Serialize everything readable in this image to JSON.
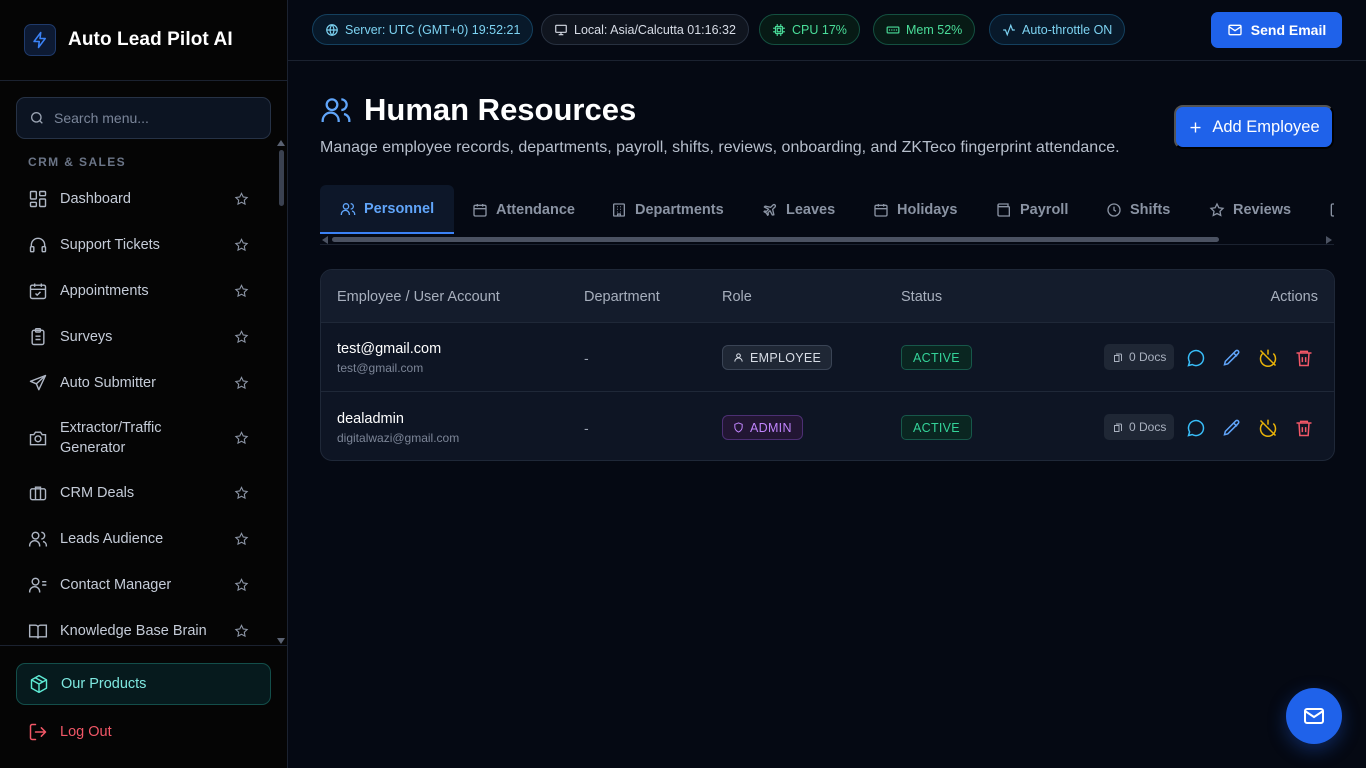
{
  "brand": {
    "name": "Auto Lead Pilot AI"
  },
  "sidebar": {
    "search_placeholder": "Search menu...",
    "section_label": "CRM & SALES",
    "items": [
      {
        "label": "Dashboard",
        "icon": "dashboard-icon"
      },
      {
        "label": "Support Tickets",
        "icon": "headset-icon"
      },
      {
        "label": "Appointments",
        "icon": "calendar-check-icon"
      },
      {
        "label": "Surveys",
        "icon": "clipboard-list-icon"
      },
      {
        "label": "Auto Submitter",
        "icon": "send-icon"
      },
      {
        "label": "Extractor/Traffic Generator",
        "icon": "camera-icon"
      },
      {
        "label": "CRM Deals",
        "icon": "briefcase-icon"
      },
      {
        "label": "Leads Audience",
        "icon": "users-icon"
      },
      {
        "label": "Contact Manager",
        "icon": "contacts-icon"
      },
      {
        "label": "Knowledge Base Brain",
        "icon": "book-open-icon"
      }
    ],
    "products_label": "Our Products",
    "logout_label": "Log Out"
  },
  "topbar": {
    "server": "Server: UTC (GMT+0) 19:52:21",
    "local": "Local: Asia/Calcutta 01:16:32",
    "cpu": "CPU 17%",
    "mem": "Mem 52%",
    "auto_throttle": "Auto-throttle ON",
    "send_email": "Send Email"
  },
  "page": {
    "title": "Human Resources",
    "subtitle": "Manage employee records, departments, payroll, shifts, reviews, onboarding, and ZKTeco fingerprint attendance.",
    "add_button": "Add Employee"
  },
  "tabs": [
    {
      "label": "Personnel",
      "icon": "users-icon",
      "active": true
    },
    {
      "label": "Attendance",
      "icon": "calendar-icon",
      "active": false
    },
    {
      "label": "Departments",
      "icon": "building-icon",
      "active": false
    },
    {
      "label": "Leaves",
      "icon": "plane-icon",
      "active": false
    },
    {
      "label": "Holidays",
      "icon": "calendar-grid-icon",
      "active": false
    },
    {
      "label": "Payroll",
      "icon": "wallet-icon",
      "active": false
    },
    {
      "label": "Shifts",
      "icon": "clock-icon",
      "active": false
    },
    {
      "label": "Reviews",
      "icon": "star-icon",
      "active": false
    }
  ],
  "table": {
    "headers": {
      "employee": "Employee / User Account",
      "department": "Department",
      "role": "Role",
      "status": "Status",
      "actions": "Actions"
    },
    "rows": [
      {
        "name": "test@gmail.com",
        "email": "test@gmail.com",
        "department": "-",
        "role": "EMPLOYEE",
        "status": "ACTIVE",
        "docs": "0 Docs"
      },
      {
        "name": "dealadmin",
        "email": "digitalwazi@gmail.com",
        "department": "-",
        "role": "ADMIN",
        "status": "ACTIVE",
        "docs": "0 Docs"
      }
    ]
  },
  "colors": {
    "accent": "#1f62ea",
    "active_tab": "#60a5fa",
    "status_active": "#34d399",
    "admin_role": "#c084fc",
    "danger": "#f25767",
    "warning": "#eab308"
  }
}
